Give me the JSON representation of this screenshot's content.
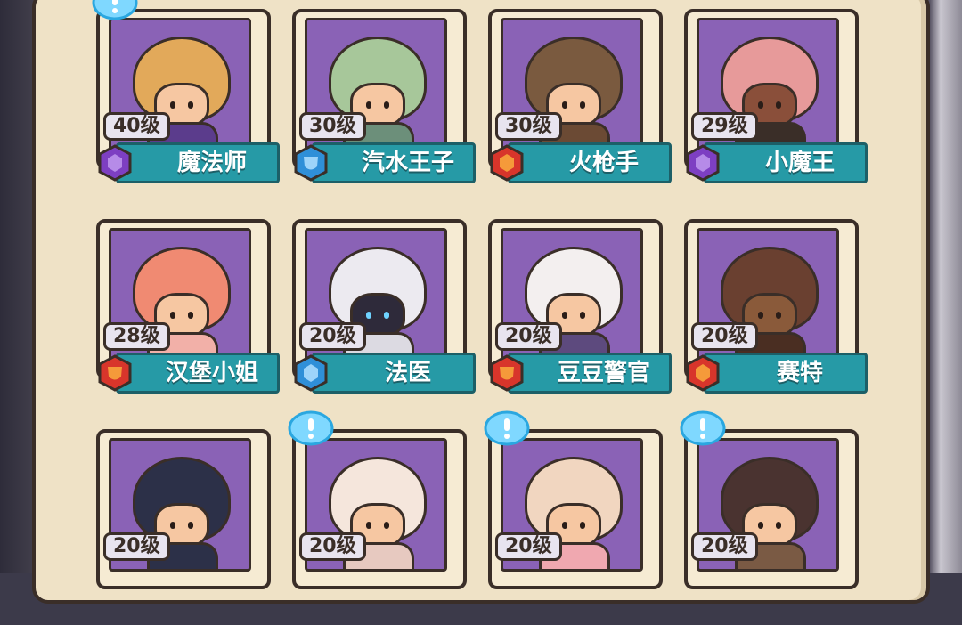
{
  "colors": {
    "purple_badge": "#7d3fc2",
    "blue_badge": "#2f8fd8",
    "red_badge": "#d8352b",
    "nameplate": "#269aa6",
    "portrait_bg": "#8a62b6"
  },
  "cards": [
    {
      "level": "40级",
      "name": "魔法师",
      "badge": "purple"
    },
    {
      "level": "30级",
      "name": "汽水王子",
      "badge": "blue"
    },
    {
      "level": "30级",
      "name": "火枪手",
      "badge": "red"
    },
    {
      "level": "29级",
      "name": "小魔王",
      "badge": "purple"
    },
    {
      "level": "28级",
      "name": "汉堡小姐",
      "badge": "red"
    },
    {
      "level": "20级",
      "name": "法医",
      "badge": "blue"
    },
    {
      "level": "20级",
      "name": "豆豆警官",
      "badge": "red"
    },
    {
      "level": "20级",
      "name": "赛特",
      "badge": "red"
    },
    {
      "level": "20级",
      "name": "",
      "badge": ""
    },
    {
      "level": "20级",
      "name": "",
      "badge": ""
    },
    {
      "level": "20级",
      "name": "",
      "badge": ""
    },
    {
      "level": "20级",
      "name": "",
      "badge": ""
    }
  ],
  "alert_icons": [
    "exclamation-bubble-icon",
    "exclamation-bubble-icon",
    "exclamation-bubble-icon",
    "exclamation-bubble-icon"
  ]
}
